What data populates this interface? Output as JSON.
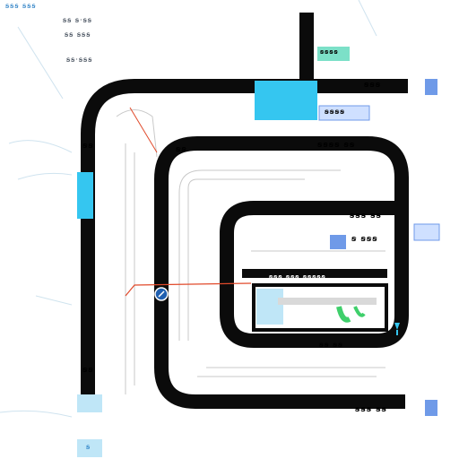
{
  "labels": {
    "top_left_header": "ꞩꞩꞩ ꞩꞩꞩ",
    "legend_1": "ꞩꞩ ꞩ·ꞩꞩ",
    "legend_2": "ꞩꞩ ꞩꞩꞩ",
    "legend_3": "ꞩꞩ·ꞩꞩꞩ",
    "top_right_1": "ꞩꞩꞩ",
    "top_right_2": "ꞩꞩꞩꞩ",
    "right_loop2": "ꞩꞩꞩꞩ ꞩꞩ",
    "right_loop3": "ꞩꞩꞩ ꞩꞩ",
    "inner_right": "ꞩ ꞩꞩꞩ",
    "inner_mid": "ꞩꞩꞩ ꞩꞩꞩ ꞩꞩꞩꞩꞩ",
    "inner_bottom": "ꞩꞩ ꞩꞩ",
    "loop2_tl": "ꞩꞩ",
    "left_mid": "ꞩꞩ",
    "left_low": "ꞩꞩ",
    "bottom_right": "ꞩꞩꞩ ꞩꞩ",
    "chip_label": "ꞩꞩꞩꞩ",
    "bottom_marker": "ꞩ"
  },
  "colors": {
    "track": "#0b0b0b",
    "cyan": "#35c6f0",
    "cyan_light": "#bfe6f7",
    "teal": "#7ce0c8",
    "blue": "#6f9ae8",
    "red": "#e14a2b",
    "green": "#3fcf6b"
  },
  "icons": {
    "node": "compass-node-icon",
    "pin": "down-pin-icon"
  }
}
